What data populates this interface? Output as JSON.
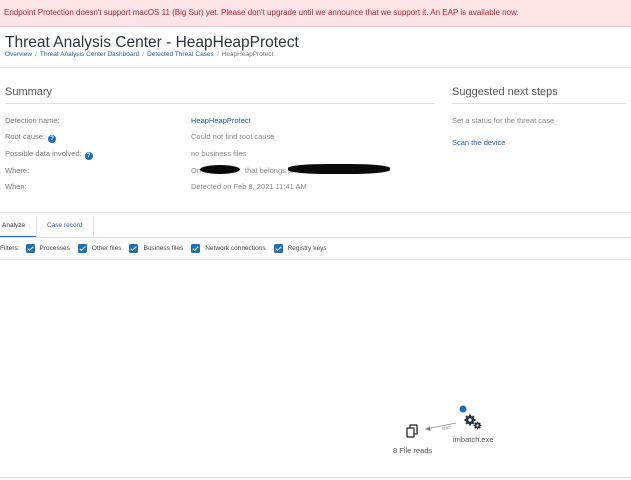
{
  "banner": {
    "message": "Endpoint Protection doesn't support macOS 11 (Big Sur) yet. Please don't upgrade until we announce that we support it. An EAP is available now."
  },
  "header": {
    "title": "Threat Analysis Center - HeapHeapProtect",
    "breadcrumb": [
      "Overview",
      "Threat Analysis Center Dashboard",
      "Detected Threat Cases",
      "HeapHeapProtect"
    ]
  },
  "summary": {
    "title": "Summary",
    "rows": [
      {
        "label": "Detection name:",
        "value": "HeapHeapProtect"
      },
      {
        "label": "Root cause:",
        "value": "Could not find root cause"
      },
      {
        "label": "Possible data involved:",
        "value": "no business files"
      },
      {
        "label": "Where:",
        "value_prefix": "On",
        "value_mid": "that belongs to"
      },
      {
        "label": "When:",
        "value": "Detected on Feb 8, 2021 11:41 AM"
      }
    ]
  },
  "next_steps": {
    "title": "Suggested next steps",
    "status_text": "Set a status for the threat case",
    "scan_link": "Scan the device"
  },
  "tabs": [
    "Analyze",
    "Case record"
  ],
  "filters": {
    "label": "Filters:",
    "items": [
      "Processes",
      "Other files",
      "Business files",
      "Network connections",
      "Registry keys"
    ]
  },
  "graph": {
    "file_node_label": "8 File reads",
    "edge_label": "read",
    "process_node_label": "imbatch.exe"
  },
  "colors": {
    "accent": "#1f6fb8",
    "banner_bg": "#fbe3e6",
    "banner_text": "#b3262f"
  }
}
